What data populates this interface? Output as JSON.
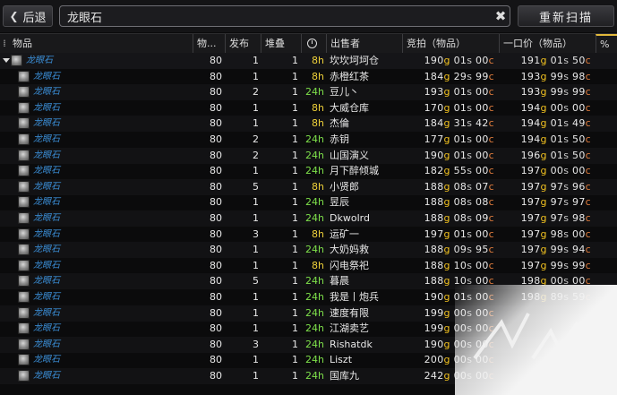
{
  "toolbar": {
    "back_label": "后退",
    "search_value": "龙眼石",
    "scan_label": "重新扫描"
  },
  "columns": [
    {
      "key": "item",
      "label": "物品"
    },
    {
      "key": "level",
      "label": "物..."
    },
    {
      "key": "posted",
      "label": "发布"
    },
    {
      "key": "stack",
      "label": "堆叠"
    },
    {
      "key": "time",
      "label": ""
    },
    {
      "key": "seller",
      "label": "出售者"
    },
    {
      "key": "bid",
      "label": "竞拍（物品）"
    },
    {
      "key": "buyout",
      "label": "一口价（物品）"
    },
    {
      "key": "pct",
      "label": "%"
    }
  ],
  "parent_row": {
    "item": "龙眼石",
    "level": "80",
    "posted": "1",
    "stack": "1",
    "time": "8h",
    "seller": "坎坎坷坷仓",
    "bid": [
      "190",
      "01",
      "00"
    ],
    "buyout": [
      "191",
      "01",
      "50"
    ]
  },
  "rows": [
    {
      "item": "龙眼石",
      "level": "80",
      "posted": "1",
      "stack": "1",
      "time": "8h",
      "seller": "赤橙红茶",
      "bid": [
        "184",
        "29",
        "99"
      ],
      "buyout": [
        "193",
        "99",
        "98"
      ]
    },
    {
      "item": "龙眼石",
      "level": "80",
      "posted": "2",
      "stack": "1",
      "time": "24h",
      "seller": "豆儿丶",
      "bid": [
        "193",
        "01",
        "00"
      ],
      "buyout": [
        "193",
        "99",
        "99"
      ]
    },
    {
      "item": "龙眼石",
      "level": "80",
      "posted": "1",
      "stack": "1",
      "time": "8h",
      "seller": "大威仓库",
      "bid": [
        "170",
        "01",
        "00"
      ],
      "buyout": [
        "194",
        "00",
        "00"
      ]
    },
    {
      "item": "龙眼石",
      "level": "80",
      "posted": "1",
      "stack": "1",
      "time": "8h",
      "seller": "杰倫",
      "bid": [
        "184",
        "31",
        "42"
      ],
      "buyout": [
        "194",
        "01",
        "49"
      ]
    },
    {
      "item": "龙眼石",
      "level": "80",
      "posted": "2",
      "stack": "1",
      "time": "24h",
      "seller": "赤钥",
      "bid": [
        "177",
        "01",
        "00"
      ],
      "buyout": [
        "194",
        "01",
        "50"
      ]
    },
    {
      "item": "龙眼石",
      "level": "80",
      "posted": "2",
      "stack": "1",
      "time": "24h",
      "seller": "山国演义",
      "bid": [
        "190",
        "01",
        "00"
      ],
      "buyout": [
        "196",
        "01",
        "50"
      ]
    },
    {
      "item": "龙眼石",
      "level": "80",
      "posted": "1",
      "stack": "1",
      "time": "24h",
      "seller": "月下醉倾城",
      "bid": [
        "182",
        "55",
        "00"
      ],
      "buyout": [
        "197",
        "00",
        "00"
      ]
    },
    {
      "item": "龙眼石",
      "level": "80",
      "posted": "5",
      "stack": "1",
      "time": "8h",
      "seller": "小贤郎",
      "bid": [
        "188",
        "08",
        "07"
      ],
      "buyout": [
        "197",
        "97",
        "96"
      ]
    },
    {
      "item": "龙眼石",
      "level": "80",
      "posted": "1",
      "stack": "1",
      "time": "24h",
      "seller": "昱辰",
      "bid": [
        "188",
        "08",
        "08"
      ],
      "buyout": [
        "197",
        "97",
        "97"
      ]
    },
    {
      "item": "龙眼石",
      "level": "80",
      "posted": "1",
      "stack": "1",
      "time": "24h",
      "seller": "Dkwolrd",
      "bid": [
        "188",
        "08",
        "09"
      ],
      "buyout": [
        "197",
        "97",
        "98"
      ]
    },
    {
      "item": "龙眼石",
      "level": "80",
      "posted": "3",
      "stack": "1",
      "time": "8h",
      "seller": "运矿一",
      "bid": [
        "197",
        "01",
        "00"
      ],
      "buyout": [
        "197",
        "98",
        "00"
      ]
    },
    {
      "item": "龙眼石",
      "level": "80",
      "posted": "1",
      "stack": "1",
      "time": "24h",
      "seller": "大奶妈救",
      "bid": [
        "188",
        "09",
        "95"
      ],
      "buyout": [
        "197",
        "99",
        "94"
      ]
    },
    {
      "item": "龙眼石",
      "level": "80",
      "posted": "1",
      "stack": "1",
      "time": "8h",
      "seller": "闪电祭祀",
      "bid": [
        "188",
        "10",
        "00"
      ],
      "buyout": [
        "197",
        "99",
        "99"
      ]
    },
    {
      "item": "龙眼石",
      "level": "80",
      "posted": "5",
      "stack": "1",
      "time": "24h",
      "seller": "暮晨",
      "bid": [
        "188",
        "10",
        "00"
      ],
      "buyout": [
        "198",
        "00",
        "00"
      ]
    },
    {
      "item": "龙眼石",
      "level": "80",
      "posted": "1",
      "stack": "1",
      "time": "24h",
      "seller": "我是丨炮兵",
      "bid": [
        "190",
        "01",
        "00"
      ],
      "buyout": [
        "198",
        "89",
        "59"
      ]
    },
    {
      "item": "龙眼石",
      "level": "80",
      "posted": "1",
      "stack": "1",
      "time": "24h",
      "seller": "速度有限",
      "bid": [
        "199",
        "00",
        "00"
      ],
      "buyout": [
        "",
        "",
        ""
      ]
    },
    {
      "item": "龙眼石",
      "level": "80",
      "posted": "1",
      "stack": "1",
      "time": "24h",
      "seller": "江湖卖艺",
      "bid": [
        "199",
        "00",
        "00"
      ],
      "buyout": [
        "",
        "",
        ""
      ]
    },
    {
      "item": "龙眼石",
      "level": "80",
      "posted": "3",
      "stack": "1",
      "time": "24h",
      "seller": "Rishatdk",
      "bid": [
        "190",
        "00",
        "00"
      ],
      "buyout": [
        "",
        "",
        ""
      ]
    },
    {
      "item": "龙眼石",
      "level": "80",
      "posted": "1",
      "stack": "1",
      "time": "24h",
      "seller": "Liszt",
      "bid": [
        "200",
        "00",
        "00"
      ],
      "buyout": [
        "",
        "",
        ""
      ]
    },
    {
      "item": "龙眼石",
      "level": "80",
      "posted": "1",
      "stack": "1",
      "time": "24h",
      "seller": "国库九",
      "bid": [
        "242",
        "00",
        "00"
      ],
      "buyout": [
        "",
        "",
        ""
      ]
    }
  ],
  "currency": {
    "gold": "g",
    "silver": "s",
    "copper": "c"
  },
  "colors": {
    "accent": "#e2b93b",
    "time_24h": "#7ee04a",
    "time_8h": "#f0d23a",
    "item_link": "#3b8fd8"
  }
}
